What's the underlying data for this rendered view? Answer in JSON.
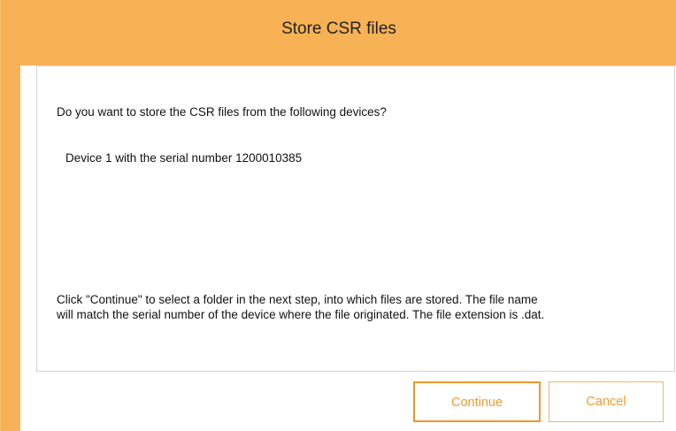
{
  "window": {
    "title": "Store CSR files"
  },
  "dialog": {
    "question": "Do you want to store the CSR files from the following devices?",
    "devices": [
      "Device 1 with the serial number 1200010385"
    ],
    "instructions_line1": "Click \"Continue\" to select a folder in the next step, into which files are stored. The file name",
    "instructions_line2": "will match the serial number of the device where the file originated. The file extension is .dat."
  },
  "buttons": {
    "continue_label": "Continue",
    "cancel_label": "Cancel"
  },
  "colors": {
    "titlebar": "#f7b255",
    "accent": "#f0962a",
    "button_text": "#f29a2e"
  }
}
